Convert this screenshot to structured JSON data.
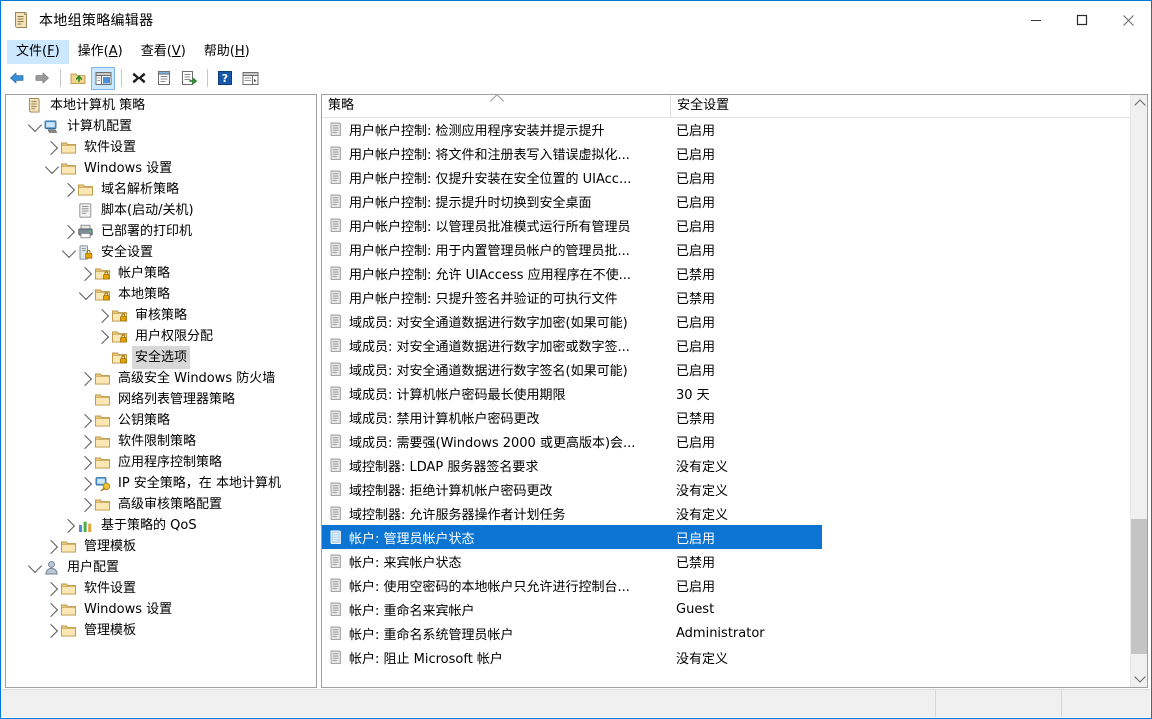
{
  "window": {
    "title": "本地组策略编辑器",
    "icon": "policy-document-icon",
    "minimize_label": "最小化",
    "maximize_label": "最大化",
    "close_label": "关闭"
  },
  "menubar": {
    "items": [
      {
        "label": "文件(F)",
        "text": "文件(",
        "accel": "F",
        "tail": ")",
        "name": "menu-file",
        "active": true
      },
      {
        "label": "操作(A)",
        "text": "操作(",
        "accel": "A",
        "tail": ")",
        "name": "menu-action",
        "active": false
      },
      {
        "label": "查看(V)",
        "text": "查看(",
        "accel": "V",
        "tail": ")",
        "name": "menu-view",
        "active": false
      },
      {
        "label": "帮助(H)",
        "text": "帮助(",
        "accel": "H",
        "tail": ")",
        "name": "menu-help",
        "active": false
      }
    ]
  },
  "toolbar": {
    "buttons": [
      {
        "name": "back-button",
        "icon": "back-arrow-icon",
        "pressed": false
      },
      {
        "name": "forward-button",
        "icon": "forward-arrow-icon",
        "pressed": false
      },
      {
        "name": "up-one-level-button",
        "icon": "up-folder-icon",
        "pressed": false
      },
      {
        "name": "show-hide-tree-button",
        "icon": "console-tree-icon",
        "pressed": true
      },
      {
        "name": "delete-button",
        "icon": "delete-x-icon",
        "pressed": false
      },
      {
        "name": "properties-button",
        "icon": "properties-icon",
        "pressed": false
      },
      {
        "name": "export-list-button",
        "icon": "export-list-icon",
        "pressed": false
      },
      {
        "name": "help-button",
        "icon": "help-question-icon",
        "pressed": false
      },
      {
        "name": "view-options-button",
        "icon": "view-options-icon",
        "pressed": false
      }
    ]
  },
  "tree": {
    "root_label": "本地计算机 策略",
    "items": [
      {
        "label": "本地计算机 策略",
        "indent": 0,
        "twisty": "none",
        "icon": "policy-document-icon",
        "selected": false,
        "name": "tree-item-local-computer-policy"
      },
      {
        "label": "计算机配置",
        "indent": 1,
        "twisty": "down",
        "icon": "computer-icon",
        "selected": false,
        "name": "tree-item-computer-configuration"
      },
      {
        "label": "软件设置",
        "indent": 2,
        "twisty": "right",
        "icon": "folder-icon",
        "selected": false,
        "name": "tree-item-software-settings"
      },
      {
        "label": "Windows 设置",
        "indent": 2,
        "twisty": "down",
        "icon": "folder-icon",
        "selected": false,
        "name": "tree-item-windows-settings"
      },
      {
        "label": "域名解析策略",
        "indent": 3,
        "twisty": "right",
        "icon": "folder-icon",
        "selected": false,
        "name": "tree-item-name-resolution-policy"
      },
      {
        "label": "脚本(启动/关机)",
        "indent": 3,
        "twisty": "none",
        "icon": "script-icon",
        "selected": false,
        "name": "tree-item-scripts"
      },
      {
        "label": "已部署的打印机",
        "indent": 3,
        "twisty": "right",
        "icon": "printer-icon",
        "selected": false,
        "name": "tree-item-deployed-printers"
      },
      {
        "label": "安全设置",
        "indent": 3,
        "twisty": "down",
        "icon": "security-settings-icon",
        "selected": false,
        "name": "tree-item-security-settings"
      },
      {
        "label": "帐户策略",
        "indent": 4,
        "twisty": "right",
        "icon": "locked-folder-icon",
        "selected": false,
        "name": "tree-item-account-policies"
      },
      {
        "label": "本地策略",
        "indent": 4,
        "twisty": "down",
        "icon": "locked-folder-icon",
        "selected": false,
        "name": "tree-item-local-policies"
      },
      {
        "label": "审核策略",
        "indent": 5,
        "twisty": "right",
        "icon": "locked-folder-icon",
        "selected": false,
        "name": "tree-item-audit-policy"
      },
      {
        "label": "用户权限分配",
        "indent": 5,
        "twisty": "right",
        "icon": "locked-folder-icon",
        "selected": false,
        "name": "tree-item-user-rights-assignment"
      },
      {
        "label": "安全选项",
        "indent": 5,
        "twisty": "none",
        "icon": "locked-folder-icon",
        "selected": true,
        "name": "tree-item-security-options"
      },
      {
        "label": "高级安全 Windows 防火墙",
        "indent": 4,
        "twisty": "right",
        "icon": "folder-icon",
        "selected": false,
        "name": "tree-item-windows-firewall"
      },
      {
        "label": "网络列表管理器策略",
        "indent": 4,
        "twisty": "none",
        "icon": "folder-icon",
        "selected": false,
        "name": "tree-item-network-list-manager"
      },
      {
        "label": "公钥策略",
        "indent": 4,
        "twisty": "right",
        "icon": "folder-icon",
        "selected": false,
        "name": "tree-item-public-key-policies"
      },
      {
        "label": "软件限制策略",
        "indent": 4,
        "twisty": "right",
        "icon": "folder-icon",
        "selected": false,
        "name": "tree-item-software-restriction-policies"
      },
      {
        "label": "应用程序控制策略",
        "indent": 4,
        "twisty": "right",
        "icon": "folder-icon",
        "selected": false,
        "name": "tree-item-application-control-policies"
      },
      {
        "label": "IP 安全策略，在 本地计算机",
        "indent": 4,
        "twisty": "right",
        "icon": "ip-security-icon",
        "selected": false,
        "name": "tree-item-ip-security-policies"
      },
      {
        "label": "高级审核策略配置",
        "indent": 4,
        "twisty": "right",
        "icon": "folder-icon",
        "selected": false,
        "name": "tree-item-advanced-audit-policy"
      },
      {
        "label": "基于策略的 QoS",
        "indent": 3,
        "twisty": "right",
        "icon": "qos-chart-icon",
        "selected": false,
        "name": "tree-item-policy-based-qos"
      },
      {
        "label": "管理模板",
        "indent": 2,
        "twisty": "right",
        "icon": "folder-icon",
        "selected": false,
        "name": "tree-item-admin-templates-computer"
      },
      {
        "label": "用户配置",
        "indent": 1,
        "twisty": "down",
        "icon": "user-icon",
        "selected": false,
        "name": "tree-item-user-configuration"
      },
      {
        "label": "软件设置",
        "indent": 2,
        "twisty": "right",
        "icon": "folder-icon",
        "selected": false,
        "name": "tree-item-software-settings-user"
      },
      {
        "label": "Windows 设置",
        "indent": 2,
        "twisty": "right",
        "icon": "folder-icon",
        "selected": false,
        "name": "tree-item-windows-settings-user"
      },
      {
        "label": "管理模板",
        "indent": 2,
        "twisty": "right",
        "icon": "folder-icon",
        "selected": false,
        "name": "tree-item-admin-templates-user"
      }
    ]
  },
  "list": {
    "columns": [
      {
        "label": "策略",
        "name": "column-policy",
        "sorted": "asc"
      },
      {
        "label": "安全设置",
        "name": "column-security-setting",
        "sorted": "none"
      }
    ],
    "rows": [
      {
        "policy": "用户帐户控制: 检测应用程序安装并提示提升",
        "setting": "已启用",
        "selected": false
      },
      {
        "policy": "用户帐户控制: 将文件和注册表写入错误虚拟化...",
        "setting": "已启用",
        "selected": false
      },
      {
        "policy": "用户帐户控制: 仅提升安装在安全位置的 UIAcc...",
        "setting": "已启用",
        "selected": false
      },
      {
        "policy": "用户帐户控制: 提示提升时切换到安全桌面",
        "setting": "已启用",
        "selected": false
      },
      {
        "policy": "用户帐户控制: 以管理员批准模式运行所有管理员",
        "setting": "已启用",
        "selected": false
      },
      {
        "policy": "用户帐户控制: 用于内置管理员帐户的管理员批...",
        "setting": "已启用",
        "selected": false
      },
      {
        "policy": "用户帐户控制: 允许 UIAccess 应用程序在不使...",
        "setting": "已禁用",
        "selected": false
      },
      {
        "policy": "用户帐户控制: 只提升签名并验证的可执行文件",
        "setting": "已禁用",
        "selected": false
      },
      {
        "policy": "域成员: 对安全通道数据进行数字加密(如果可能)",
        "setting": "已启用",
        "selected": false
      },
      {
        "policy": "域成员: 对安全通道数据进行数字加密或数字签...",
        "setting": "已启用",
        "selected": false
      },
      {
        "policy": "域成员: 对安全通道数据进行数字签名(如果可能)",
        "setting": "已启用",
        "selected": false
      },
      {
        "policy": "域成员: 计算机帐户密码最长使用期限",
        "setting": "30 天",
        "selected": false
      },
      {
        "policy": "域成员: 禁用计算机帐户密码更改",
        "setting": "已禁用",
        "selected": false
      },
      {
        "policy": "域成员: 需要强(Windows 2000 或更高版本)会...",
        "setting": "已启用",
        "selected": false
      },
      {
        "policy": "域控制器: LDAP 服务器签名要求",
        "setting": "没有定义",
        "selected": false
      },
      {
        "policy": "域控制器: 拒绝计算机帐户密码更改",
        "setting": "没有定义",
        "selected": false
      },
      {
        "policy": "域控制器: 允许服务器操作者计划任务",
        "setting": "没有定义",
        "selected": false
      },
      {
        "policy": "帐户: 管理员帐户状态",
        "setting": "已启用",
        "selected": true
      },
      {
        "policy": "帐户: 来宾帐户状态",
        "setting": "已禁用",
        "selected": false
      },
      {
        "policy": "帐户: 使用空密码的本地帐户只允许进行控制台...",
        "setting": "已启用",
        "selected": false
      },
      {
        "policy": "帐户: 重命名来宾帐户",
        "setting": "Guest",
        "selected": false
      },
      {
        "policy": "帐户: 重命名系统管理员帐户",
        "setting": "Administrator",
        "selected": false
      },
      {
        "policy": "帐户: 阻止 Microsoft 帐户",
        "setting": "没有定义",
        "selected": false
      }
    ]
  },
  "statusbar": {
    "panes": [
      "",
      "",
      ""
    ]
  },
  "colors": {
    "selection_blue": "#0c75d4",
    "window_border": "#0078d7",
    "menu_active": "#cce8ff",
    "tree_selection_gray": "#d8d8d8",
    "scrollbar_track": "#f0f0f0",
    "scrollbar_thumb": "#c4c4c4",
    "statusbar_bg": "#f0f0f0"
  }
}
